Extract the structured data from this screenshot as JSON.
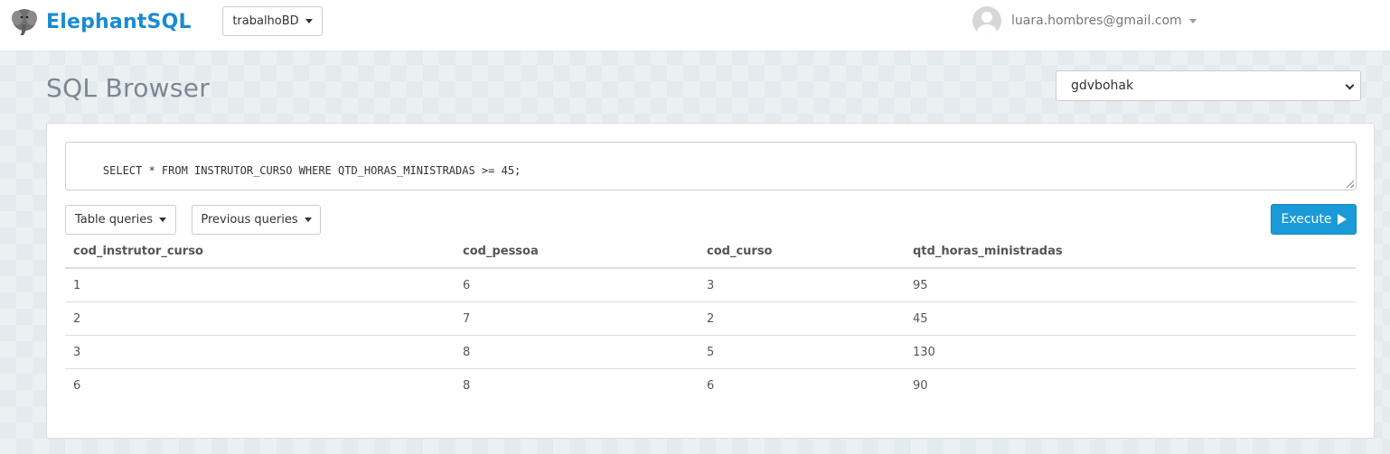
{
  "navbar": {
    "brand": "ElephantSQL",
    "instance": "trabalhoBD",
    "user_email": "luara.hombres@gmail.com"
  },
  "page": {
    "title": "SQL Browser",
    "database_selected": "gdvbohak"
  },
  "query": {
    "text": "SELECT * FROM INSTRUTOR_CURSO WHERE QTD_HORAS_MINISTRADAS >= 45;"
  },
  "buttons": {
    "table_queries": "Table queries",
    "previous_queries": "Previous queries",
    "execute": "Execute"
  },
  "results": {
    "columns": [
      "cod_instrutor_curso",
      "cod_pessoa",
      "cod_curso",
      "qtd_horas_ministradas"
    ],
    "rows": [
      [
        "1",
        "6",
        "3",
        "95"
      ],
      [
        "2",
        "7",
        "2",
        "45"
      ],
      [
        "3",
        "8",
        "5",
        "130"
      ],
      [
        "6",
        "8",
        "6",
        "90"
      ]
    ]
  },
  "colors": {
    "brand": "#1a8bd1",
    "execute_button": "#1a9bd7",
    "background": "#e4ebef"
  },
  "icons": [
    "elephant-logo-icon",
    "caret-down-icon",
    "avatar-icon",
    "play-icon",
    "select-chevron-icon",
    "resize-grip-icon"
  ]
}
